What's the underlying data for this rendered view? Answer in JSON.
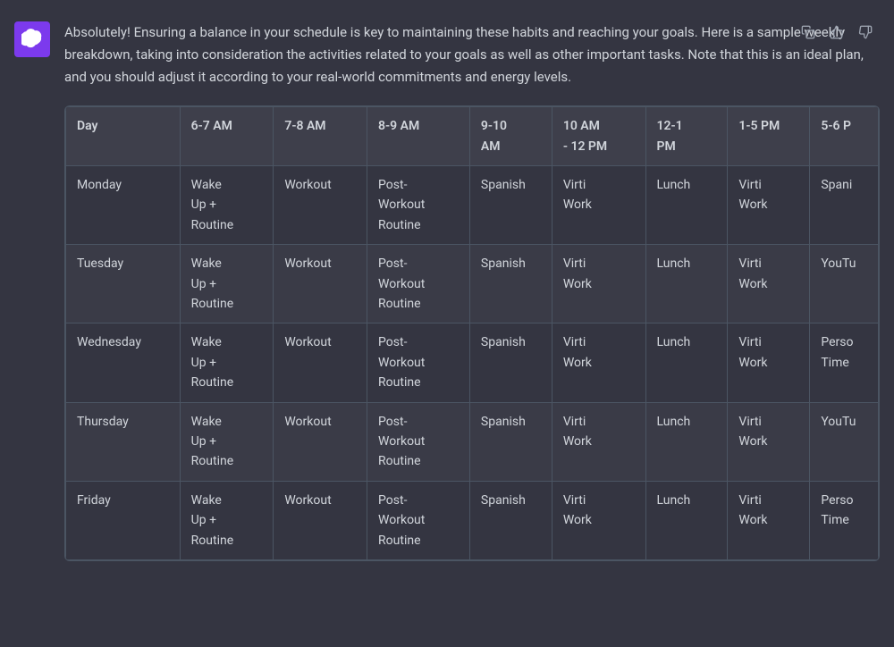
{
  "intro_text": "Absolutely! Ensuring a balance in your schedule is key to maintaining these habits and reaching your goals. Here is a sample weekly breakdown, taking into consideration the activities related to your goals as well as other important tasks. Note that this is an ideal plan, and you should adjust it according to your real-world commitments and energy levels.",
  "actions": {
    "copy_label": "Copy",
    "thumbs_up_label": "Thumbs up",
    "thumbs_down_label": "Thumbs down"
  },
  "table": {
    "headers": [
      {
        "id": "day",
        "label": "Day"
      },
      {
        "id": "6am",
        "label": "6-7 AM"
      },
      {
        "id": "7am",
        "label": "7-8 AM"
      },
      {
        "id": "8am",
        "label": "8-9 AM"
      },
      {
        "id": "9am",
        "label": "9-10\nAM"
      },
      {
        "id": "10am",
        "label": "10 AM\n- 12 PM"
      },
      {
        "id": "12pm",
        "label": "12-1\nPM"
      },
      {
        "id": "1pm",
        "label": "1-5 PM"
      },
      {
        "id": "5pm",
        "label": "5-6 P"
      }
    ],
    "rows": [
      {
        "day": "Monday",
        "6am": "Wake\nUp +\nRoutine",
        "7am": "Workout",
        "8am": "Post-\nWorkout\nRoutine",
        "9am": "Spanish",
        "10am": "Virti\nWork",
        "12pm": "Lunch",
        "1pm": "Virti\nWork",
        "5pm": "Spani"
      },
      {
        "day": "Tuesday",
        "6am": "Wake\nUp +\nRoutine",
        "7am": "Workout",
        "8am": "Post-\nWorkout\nRoutine",
        "9am": "Spanish",
        "10am": "Virti\nWork",
        "12pm": "Lunch",
        "1pm": "Virti\nWork",
        "5pm": "YouTu"
      },
      {
        "day": "Wednesday",
        "6am": "Wake\nUp +\nRoutine",
        "7am": "Workout",
        "8am": "Post-\nWorkout\nRoutine",
        "9am": "Spanish",
        "10am": "Virti\nWork",
        "12pm": "Lunch",
        "1pm": "Virti\nWork",
        "5pm": "Perso\nTime"
      },
      {
        "day": "Thursday",
        "6am": "Wake\nUp +\nRoutine",
        "7am": "Workout",
        "8am": "Post-\nWorkout\nRoutine",
        "9am": "Spanish",
        "10am": "Virti\nWork",
        "12pm": "Lunch",
        "1pm": "Virti\nWork",
        "5pm": "YouTu"
      },
      {
        "day": "Friday",
        "6am": "Wake\nUp +\nRoutine",
        "7am": "Workout",
        "8am": "Post-\nWorkout\nRoutine",
        "9am": "Spanish",
        "10am": "Virti\nWork",
        "12pm": "Lunch",
        "1pm": "Virti\nWork",
        "5pm": "Perso\nTime"
      }
    ]
  }
}
